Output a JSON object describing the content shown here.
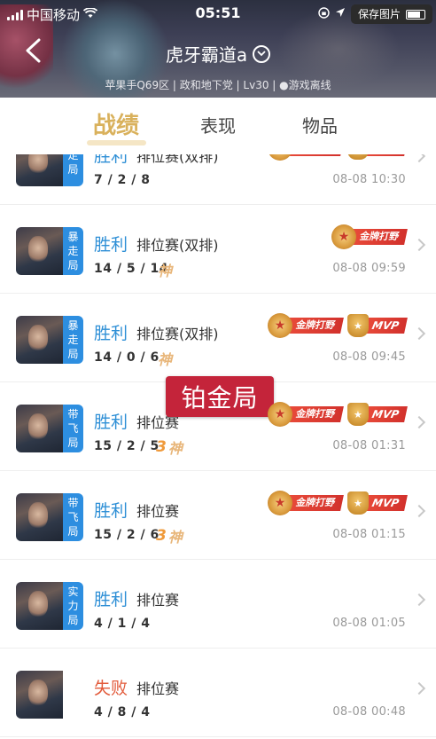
{
  "status_bar": {
    "carrier": "中国移动",
    "time": "05:51",
    "save_button": "保存图片",
    "battery": "57%"
  },
  "header": {
    "player_name": "虎牙霸道a",
    "info": "苹果手Q69区 | 政和地下党 | Lv30 | ●游戏离线"
  },
  "tabs": [
    {
      "label": "战绩",
      "active": true
    },
    {
      "label": "表现",
      "active": false
    },
    {
      "label": "物品",
      "active": false
    }
  ],
  "overlay_label": "铂金局",
  "matches": [
    {
      "mode": [
        "走",
        "局"
      ],
      "result": "胜利",
      "result_type": "win",
      "match_type": "排位赛(双排)",
      "kda": "7 / 2 / 8",
      "tag_num": "",
      "tag_god": "",
      "badges": [
        "金牌打野",
        "MVP"
      ],
      "date": "08-08 10:30"
    },
    {
      "mode": [
        "暴",
        "走",
        "局"
      ],
      "result": "胜利",
      "result_type": "win",
      "match_type": "排位赛(双排)",
      "kda": "14 / 5 / 14",
      "tag_num": "",
      "tag_god": "神",
      "badges": [
        "金牌打野"
      ],
      "date": "08-08 09:59"
    },
    {
      "mode": [
        "暴",
        "走",
        "局"
      ],
      "result": "胜利",
      "result_type": "win",
      "match_type": "排位赛(双排)",
      "kda": "14 / 0 / 6",
      "tag_num": "",
      "tag_god": "神",
      "badges": [
        "金牌打野",
        "MVP"
      ],
      "date": "08-08 09:45"
    },
    {
      "mode": [
        "带",
        "飞",
        "局"
      ],
      "result": "胜利",
      "result_type": "win",
      "match_type": "排位赛",
      "kda": "15 / 2 / 5",
      "tag_num": "3",
      "tag_god": "神",
      "badges": [
        "金牌打野",
        "MVP"
      ],
      "date": "08-08 01:31"
    },
    {
      "mode": [
        "带",
        "飞",
        "局"
      ],
      "result": "胜利",
      "result_type": "win",
      "match_type": "排位赛",
      "kda": "15 / 2 / 6",
      "tag_num": "3",
      "tag_god": "神",
      "badges": [
        "金牌打野",
        "MVP"
      ],
      "date": "08-08 01:15"
    },
    {
      "mode": [
        "实",
        "力",
        "局"
      ],
      "result": "胜利",
      "result_type": "win",
      "match_type": "排位赛",
      "kda": "4 / 1 / 4",
      "tag_num": "",
      "tag_god": "",
      "badges": [],
      "date": "08-08 01:05"
    },
    {
      "mode": [],
      "result": "失败",
      "result_type": "lose",
      "match_type": "排位赛",
      "kda": "4 / 8 / 4",
      "tag_num": "",
      "tag_god": "",
      "badges": [],
      "date": "08-08 00:48"
    }
  ]
}
